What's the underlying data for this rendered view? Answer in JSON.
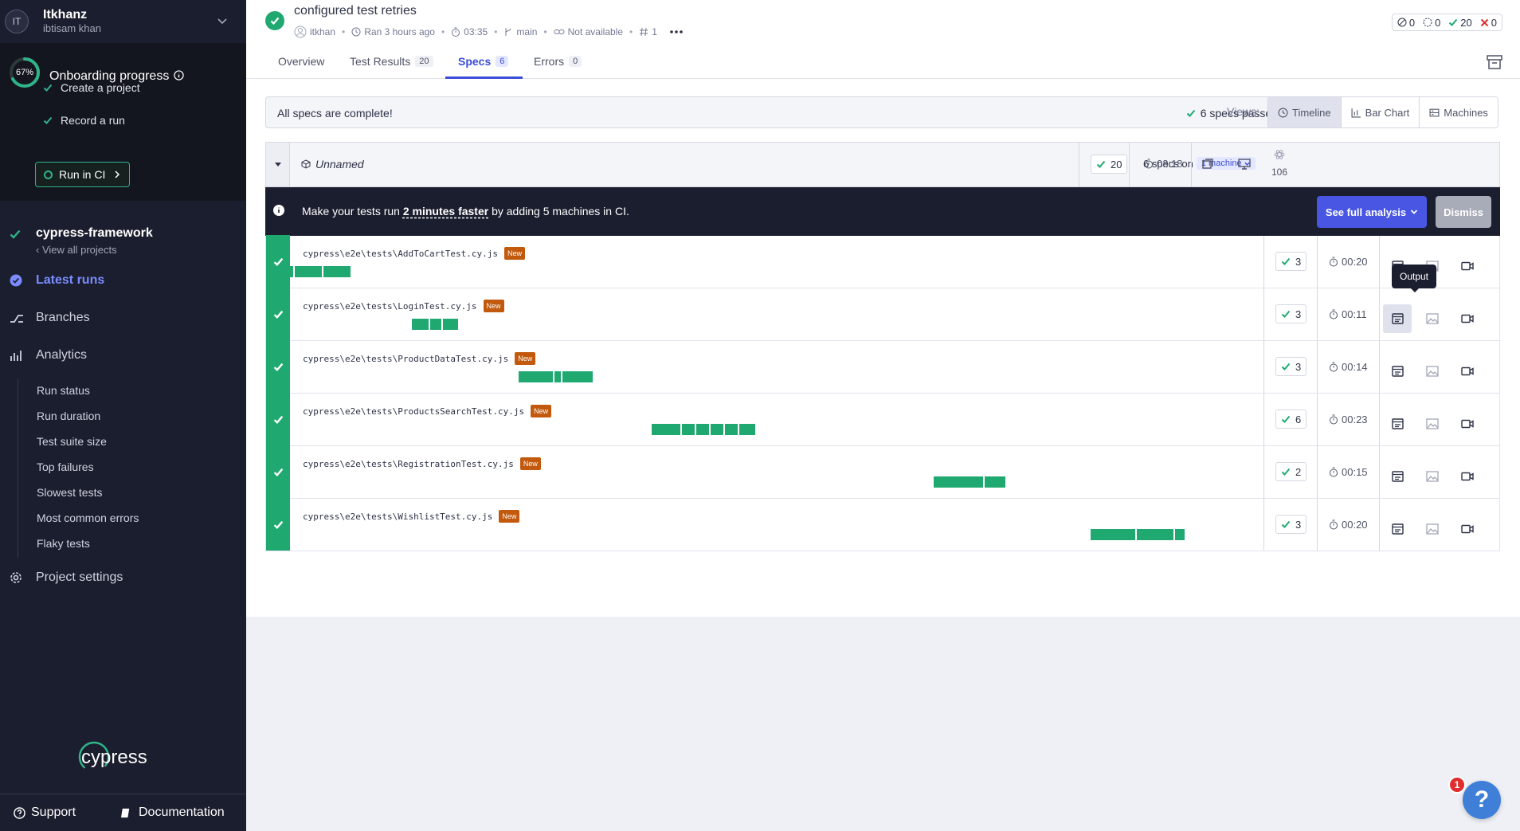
{
  "sidebar": {
    "org": {
      "avatar_initials": "IT",
      "name": "Itkhanz",
      "user": "ibtisam khan"
    },
    "onboarding": {
      "percent": "67%",
      "progress_fraction": 0.67,
      "title": "Onboarding progress",
      "steps": [
        {
          "label": "Create a project",
          "done": true
        },
        {
          "label": "Record a run",
          "done": true
        }
      ],
      "ci_button": "Run in CI"
    },
    "project": {
      "name": "cypress-framework",
      "back": "View all projects"
    },
    "nav": {
      "latest_runs": "Latest runs",
      "branches": "Branches",
      "analytics": "Analytics",
      "settings": "Project settings"
    },
    "analytics_items": [
      "Run status",
      "Run duration",
      "Test suite size",
      "Top failures",
      "Slowest tests",
      "Most common errors",
      "Flaky tests"
    ],
    "logo": "cypress",
    "footer": {
      "support": "Support",
      "documentation": "Documentation"
    }
  },
  "run": {
    "title": "configured test retries",
    "author": "itkhan",
    "ran": "Ran 3 hours ago",
    "duration": "03:35",
    "branch": "main",
    "ci": "Not available",
    "number": "1",
    "counts": {
      "skipped": "0",
      "pending": "0",
      "passed": "20",
      "failed": "0"
    }
  },
  "tabs": [
    {
      "label": "Overview",
      "count": ""
    },
    {
      "label": "Test Results",
      "count": "20"
    },
    {
      "label": "Specs",
      "count": "6"
    },
    {
      "label": "Errors",
      "count": "0"
    }
  ],
  "status_banner": {
    "message": "All specs are complete!",
    "passed": "6 specs passed"
  },
  "views": {
    "label": "Views:",
    "options": [
      "Timeline",
      "Bar Chart",
      "Machines"
    ],
    "active": "Timeline"
  },
  "group": {
    "name": "Unnamed",
    "specs_text": "6 specs on",
    "machines": "1 machine",
    "passed": "20",
    "duration": "03:18",
    "count": "106"
  },
  "promo": {
    "prefix": "Make your tests run ",
    "highlight": "2 minutes faster",
    "suffix": " by adding 5 machines in CI.",
    "cta": "See full analysis",
    "dismiss": "Dismiss"
  },
  "specs": [
    {
      "path": "cypress\\e2e\\tests\\AddToCartTest.cy.js",
      "badge": "New",
      "passed": "3",
      "duration": "00:20"
    },
    {
      "path": "cypress\\e2e\\tests\\LoginTest.cy.js",
      "badge": "New",
      "passed": "3",
      "duration": "00:11"
    },
    {
      "path": "cypress\\e2e\\tests\\ProductDataTest.cy.js",
      "badge": "New",
      "passed": "3",
      "duration": "00:14"
    },
    {
      "path": "cypress\\e2e\\tests\\ProductsSearchTest.cy.js",
      "badge": "New",
      "passed": "6",
      "duration": "00:23"
    },
    {
      "path": "cypress\\e2e\\tests\\RegistrationTest.cy.js",
      "badge": "New",
      "passed": "2",
      "duration": "00:15"
    },
    {
      "path": "cypress\\e2e\\tests\\WishlistTest.cy.js",
      "badge": "New",
      "passed": "3",
      "duration": "00:20"
    }
  ],
  "tooltip": "Output",
  "help": {
    "badge": "1",
    "icon": "?"
  },
  "colors": {
    "passed": "#1fa971",
    "accent": "#3b4cd6",
    "sidebar": "#1b1e2e",
    "new_badge": "#c2590d",
    "failed": "#e02d2d"
  }
}
